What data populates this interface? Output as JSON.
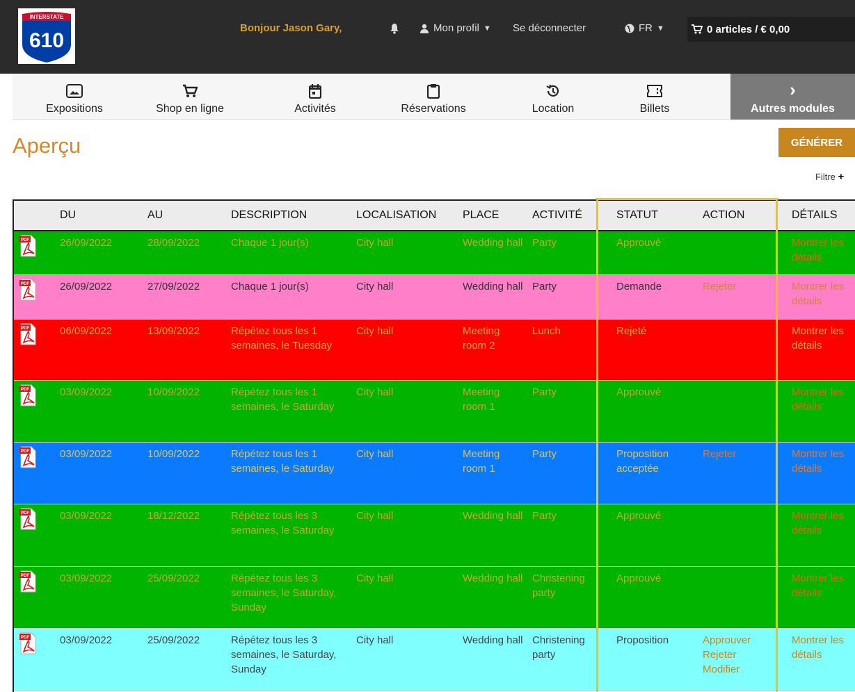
{
  "header": {
    "logo_top": "INTERSTATE",
    "logo_number": "610",
    "greeting": "Bonjour Jason Gary,",
    "profile_label": "Mon profil",
    "logout_label": "Se déconnecter",
    "language": "FR",
    "cart": "0 articles / € 0,00"
  },
  "nav": {
    "items": [
      {
        "label": "Expositions",
        "icon": "image-icon"
      },
      {
        "label": "Shop en ligne",
        "icon": "cart-icon"
      },
      {
        "label": "Activités",
        "icon": "calendar-icon"
      },
      {
        "label": "Réservations",
        "icon": "clipboard-icon"
      },
      {
        "label": "Location",
        "icon": "history-icon"
      },
      {
        "label": "Billets",
        "icon": "ticket-icon"
      }
    ],
    "more_label": "Autres modules"
  },
  "page": {
    "title": "Aperçu",
    "generate_label": "GÉNÉRER",
    "filter_label": "Filtre"
  },
  "table": {
    "headers": {
      "du": "DU",
      "au": "AU",
      "description": "DESCRIPTION",
      "localisation": "LOCALISATION",
      "place": "PLACE",
      "activite": "ACTIVITÉ",
      "statut": "STATUT",
      "action": "ACTION",
      "details": "DÉTAILS"
    },
    "rows": [
      {
        "bg": "#00b400",
        "fg": "#c6a53c",
        "linkfg": "#e0641c",
        "du": "26/09/2022",
        "au": "28/09/2022",
        "description": "Chaque 1 jour(s)",
        "localisation": "City hall",
        "place": "Wedding hall",
        "activite": "Party",
        "statut": "Approuvé",
        "actions": [],
        "details": "Montrer les détails"
      },
      {
        "bg": "#ff7fc8",
        "fg": "#333333",
        "linkfg": "#d0863a",
        "du": "26/09/2022",
        "au": "27/09/2022",
        "description": "Chaque 1 jour(s)",
        "localisation": "City hall",
        "place": "Wedding hall",
        "activite": "Party",
        "statut": "Demande",
        "actions": [
          "Rejeter"
        ],
        "details": "Montrer les détails"
      },
      {
        "bg": "#ff0000",
        "fg": "#e8a33a",
        "linkfg": "#e8a33a",
        "du": "06/09/2022",
        "au": "13/09/2022",
        "description": "Répétez tous les 1 semaines, le Tuesday",
        "localisation": "City hall",
        "place": "Meeting room 2",
        "activite": "Lunch",
        "statut": "Rejeté",
        "actions": [],
        "details": "Montrer les détails"
      },
      {
        "bg": "#00b400",
        "fg": "#c6a53c",
        "linkfg": "#e0641c",
        "du": "03/09/2022",
        "au": "10/09/2022",
        "description": "Répétez tous les 1 semaines, le Saturday",
        "localisation": "City hall",
        "place": "Meeting room 1",
        "activite": "Party",
        "statut": "Approuvé",
        "actions": [],
        "details": "Montrer les détails"
      },
      {
        "bg": "#0a7aff",
        "fg": "#dfc35a",
        "linkfg": "#e07a2a",
        "du": "03/09/2022",
        "au": "10/09/2022",
        "description": "Répétez tous les 1 semaines, le Saturday",
        "localisation": "City hall",
        "place": "Meeting room 1",
        "activite": "Party",
        "statut": "Proposition acceptée",
        "actions": [
          "Rejeter"
        ],
        "details": "Montrer les détails"
      },
      {
        "bg": "#00b400",
        "fg": "#c6a53c",
        "linkfg": "#e0641c",
        "du": "03/09/2022",
        "au": "18/12/2022",
        "description": "Répétez tous les 3 semaines, le Saturday",
        "localisation": "City hall",
        "place": "Wedding hall",
        "activite": "Party",
        "statut": "Approuvé",
        "actions": [],
        "details": "Montrer les détails"
      },
      {
        "bg": "#00b400",
        "fg": "#c6a53c",
        "linkfg": "#e0641c",
        "du": "03/09/2022",
        "au": "25/09/2022",
        "description": "Répétez tous les 3 semaines, le Saturday, Sunday",
        "localisation": "City hall",
        "place": "Wedding hall",
        "activite": "Christening party",
        "statut": "Approuvé",
        "actions": [],
        "details": "Montrer les détails"
      },
      {
        "bg": "#80ffff",
        "fg": "#444444",
        "linkfg": "#c7861f",
        "du": "03/09/2022",
        "au": "25/09/2022",
        "description": "Répétez tous les 3 semaines, le Saturday, Sunday",
        "localisation": "City hall",
        "place": "Wedding hall",
        "activite": "Christening party",
        "statut": "Proposition",
        "actions": [
          "Approuver",
          "Rejeter",
          "Modifier"
        ],
        "details": "Montrer les détails"
      }
    ]
  }
}
